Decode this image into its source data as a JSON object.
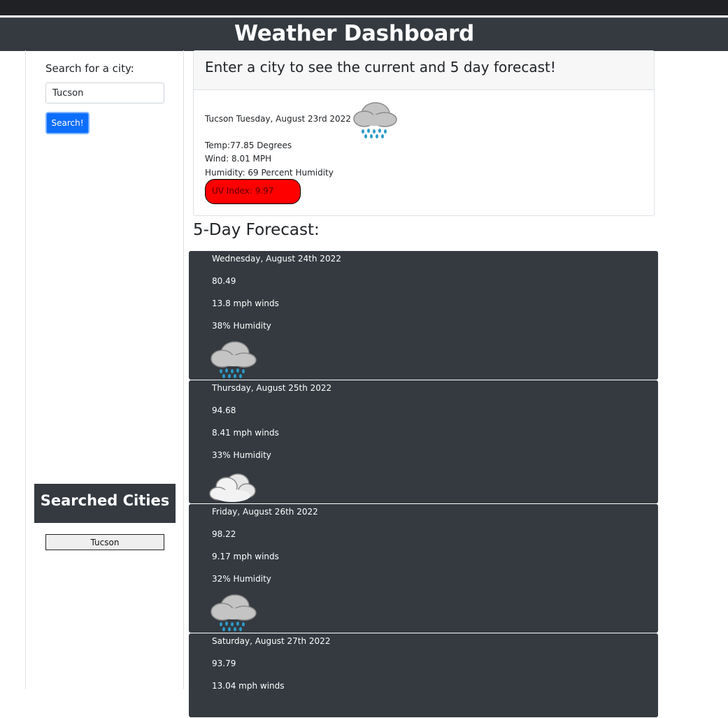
{
  "header": {
    "title": "Weather Dashboard"
  },
  "sidebar": {
    "search_label": "Search for a city:",
    "search_value": "Tucson",
    "search_button": "Search!",
    "history_title": "Searched Cities",
    "history": [
      "Tucson"
    ]
  },
  "current": {
    "heading": "Enter a city to see the current and 5 day forecast!",
    "city_date": "Tucson Tuesday, August 23rd 2022",
    "icon": "rain-cloud-icon",
    "temp": "Temp:77.85 Degrees",
    "wind": "Wind: 8.01 MPH",
    "humidity": "Humidity: 69 Percent Humidity",
    "uv": "UV Index: 9.97",
    "uv_color": "#ff0000"
  },
  "forecast": {
    "title": "5-Day Forecast:",
    "days": [
      {
        "date": "Wednesday, August 24th 2022",
        "temp": "80.49",
        "wind": "13.8 mph winds",
        "humidity": "38% Humidity",
        "icon": "rain-cloud-icon"
      },
      {
        "date": "Thursday, August 25th 2022",
        "temp": "94.68",
        "wind": "8.41 mph winds",
        "humidity": "33% Humidity",
        "icon": "clouds-icon"
      },
      {
        "date": "Friday, August 26th 2022",
        "temp": "98.22",
        "wind": "9.17 mph winds",
        "humidity": "32% Humidity",
        "icon": "rain-cloud-icon"
      },
      {
        "date": "Saturday, August 27th 2022",
        "temp": "93.79",
        "wind": "13.04 mph winds",
        "humidity": "",
        "icon": ""
      }
    ]
  },
  "colors": {
    "header_bg": "#343a40",
    "primary_button": "#0d6efd",
    "card_bg": "#343a40",
    "uv_high": "#ff0000"
  }
}
